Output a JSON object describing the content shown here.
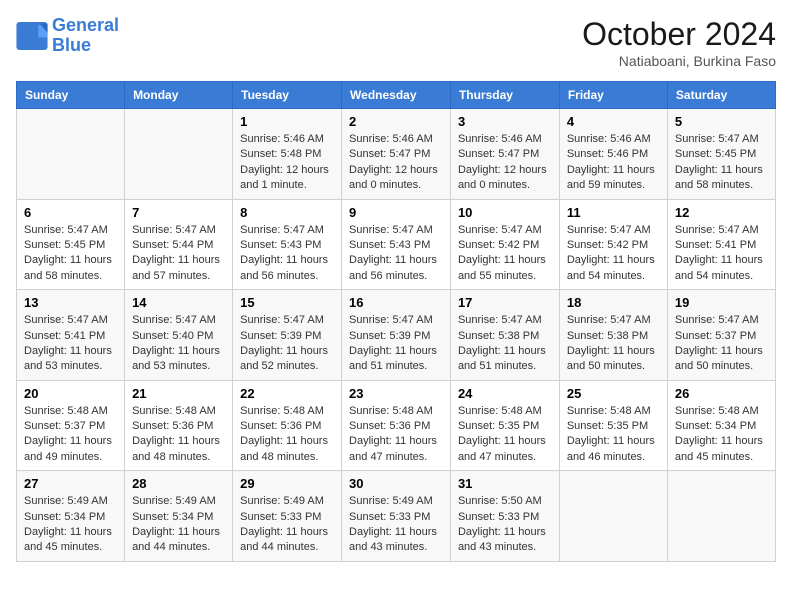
{
  "logo": {
    "text_general": "General",
    "text_blue": "Blue"
  },
  "header": {
    "month": "October 2024",
    "location": "Natiaboani, Burkina Faso"
  },
  "weekdays": [
    "Sunday",
    "Monday",
    "Tuesday",
    "Wednesday",
    "Thursday",
    "Friday",
    "Saturday"
  ],
  "weeks": [
    [
      {
        "day": "",
        "lines": []
      },
      {
        "day": "",
        "lines": []
      },
      {
        "day": "1",
        "lines": [
          "Sunrise: 5:46 AM",
          "Sunset: 5:48 PM",
          "Daylight: 12 hours",
          "and 1 minute."
        ]
      },
      {
        "day": "2",
        "lines": [
          "Sunrise: 5:46 AM",
          "Sunset: 5:47 PM",
          "Daylight: 12 hours",
          "and 0 minutes."
        ]
      },
      {
        "day": "3",
        "lines": [
          "Sunrise: 5:46 AM",
          "Sunset: 5:47 PM",
          "Daylight: 12 hours",
          "and 0 minutes."
        ]
      },
      {
        "day": "4",
        "lines": [
          "Sunrise: 5:46 AM",
          "Sunset: 5:46 PM",
          "Daylight: 11 hours",
          "and 59 minutes."
        ]
      },
      {
        "day": "5",
        "lines": [
          "Sunrise: 5:47 AM",
          "Sunset: 5:45 PM",
          "Daylight: 11 hours",
          "and 58 minutes."
        ]
      }
    ],
    [
      {
        "day": "6",
        "lines": [
          "Sunrise: 5:47 AM",
          "Sunset: 5:45 PM",
          "Daylight: 11 hours",
          "and 58 minutes."
        ]
      },
      {
        "day": "7",
        "lines": [
          "Sunrise: 5:47 AM",
          "Sunset: 5:44 PM",
          "Daylight: 11 hours",
          "and 57 minutes."
        ]
      },
      {
        "day": "8",
        "lines": [
          "Sunrise: 5:47 AM",
          "Sunset: 5:43 PM",
          "Daylight: 11 hours",
          "and 56 minutes."
        ]
      },
      {
        "day": "9",
        "lines": [
          "Sunrise: 5:47 AM",
          "Sunset: 5:43 PM",
          "Daylight: 11 hours",
          "and 56 minutes."
        ]
      },
      {
        "day": "10",
        "lines": [
          "Sunrise: 5:47 AM",
          "Sunset: 5:42 PM",
          "Daylight: 11 hours",
          "and 55 minutes."
        ]
      },
      {
        "day": "11",
        "lines": [
          "Sunrise: 5:47 AM",
          "Sunset: 5:42 PM",
          "Daylight: 11 hours",
          "and 54 minutes."
        ]
      },
      {
        "day": "12",
        "lines": [
          "Sunrise: 5:47 AM",
          "Sunset: 5:41 PM",
          "Daylight: 11 hours",
          "and 54 minutes."
        ]
      }
    ],
    [
      {
        "day": "13",
        "lines": [
          "Sunrise: 5:47 AM",
          "Sunset: 5:41 PM",
          "Daylight: 11 hours",
          "and 53 minutes."
        ]
      },
      {
        "day": "14",
        "lines": [
          "Sunrise: 5:47 AM",
          "Sunset: 5:40 PM",
          "Daylight: 11 hours",
          "and 53 minutes."
        ]
      },
      {
        "day": "15",
        "lines": [
          "Sunrise: 5:47 AM",
          "Sunset: 5:39 PM",
          "Daylight: 11 hours",
          "and 52 minutes."
        ]
      },
      {
        "day": "16",
        "lines": [
          "Sunrise: 5:47 AM",
          "Sunset: 5:39 PM",
          "Daylight: 11 hours",
          "and 51 minutes."
        ]
      },
      {
        "day": "17",
        "lines": [
          "Sunrise: 5:47 AM",
          "Sunset: 5:38 PM",
          "Daylight: 11 hours",
          "and 51 minutes."
        ]
      },
      {
        "day": "18",
        "lines": [
          "Sunrise: 5:47 AM",
          "Sunset: 5:38 PM",
          "Daylight: 11 hours",
          "and 50 minutes."
        ]
      },
      {
        "day": "19",
        "lines": [
          "Sunrise: 5:47 AM",
          "Sunset: 5:37 PM",
          "Daylight: 11 hours",
          "and 50 minutes."
        ]
      }
    ],
    [
      {
        "day": "20",
        "lines": [
          "Sunrise: 5:48 AM",
          "Sunset: 5:37 PM",
          "Daylight: 11 hours",
          "and 49 minutes."
        ]
      },
      {
        "day": "21",
        "lines": [
          "Sunrise: 5:48 AM",
          "Sunset: 5:36 PM",
          "Daylight: 11 hours",
          "and 48 minutes."
        ]
      },
      {
        "day": "22",
        "lines": [
          "Sunrise: 5:48 AM",
          "Sunset: 5:36 PM",
          "Daylight: 11 hours",
          "and 48 minutes."
        ]
      },
      {
        "day": "23",
        "lines": [
          "Sunrise: 5:48 AM",
          "Sunset: 5:36 PM",
          "Daylight: 11 hours",
          "and 47 minutes."
        ]
      },
      {
        "day": "24",
        "lines": [
          "Sunrise: 5:48 AM",
          "Sunset: 5:35 PM",
          "Daylight: 11 hours",
          "and 47 minutes."
        ]
      },
      {
        "day": "25",
        "lines": [
          "Sunrise: 5:48 AM",
          "Sunset: 5:35 PM",
          "Daylight: 11 hours",
          "and 46 minutes."
        ]
      },
      {
        "day": "26",
        "lines": [
          "Sunrise: 5:48 AM",
          "Sunset: 5:34 PM",
          "Daylight: 11 hours",
          "and 45 minutes."
        ]
      }
    ],
    [
      {
        "day": "27",
        "lines": [
          "Sunrise: 5:49 AM",
          "Sunset: 5:34 PM",
          "Daylight: 11 hours",
          "and 45 minutes."
        ]
      },
      {
        "day": "28",
        "lines": [
          "Sunrise: 5:49 AM",
          "Sunset: 5:34 PM",
          "Daylight: 11 hours",
          "and 44 minutes."
        ]
      },
      {
        "day": "29",
        "lines": [
          "Sunrise: 5:49 AM",
          "Sunset: 5:33 PM",
          "Daylight: 11 hours",
          "and 44 minutes."
        ]
      },
      {
        "day": "30",
        "lines": [
          "Sunrise: 5:49 AM",
          "Sunset: 5:33 PM",
          "Daylight: 11 hours",
          "and 43 minutes."
        ]
      },
      {
        "day": "31",
        "lines": [
          "Sunrise: 5:50 AM",
          "Sunset: 5:33 PM",
          "Daylight: 11 hours",
          "and 43 minutes."
        ]
      },
      {
        "day": "",
        "lines": []
      },
      {
        "day": "",
        "lines": []
      }
    ]
  ]
}
